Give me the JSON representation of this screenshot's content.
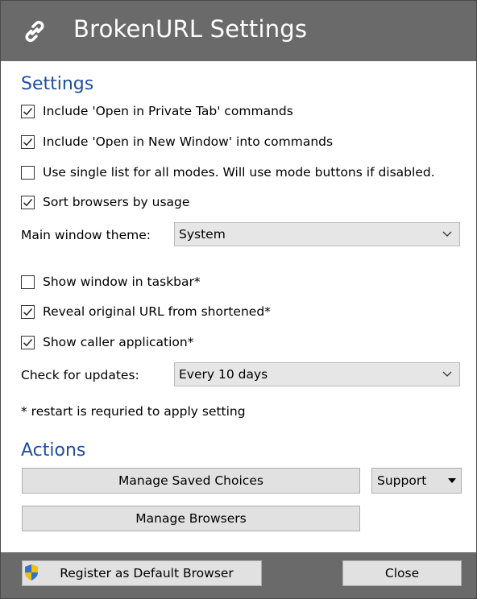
{
  "window": {
    "title": "BrokenURL Settings",
    "icon": "chain-link-icon"
  },
  "settings": {
    "heading": "Settings",
    "options": [
      {
        "label": "Include 'Open in Private Tab' commands",
        "checked": true
      },
      {
        "label": "Include 'Open in New Window' into commands",
        "checked": true
      },
      {
        "label": "Use single list for all modes. Will use mode buttons if disabled.",
        "checked": false
      },
      {
        "label": "Sort browsers by usage",
        "checked": true
      }
    ],
    "theme": {
      "label": "Main window theme:",
      "value": "System"
    },
    "options2": [
      {
        "label": "Show window in taskbar*",
        "checked": false
      },
      {
        "label": "Reveal original URL from shortened*",
        "checked": true
      },
      {
        "label": "Show caller application*",
        "checked": true
      }
    ],
    "updates": {
      "label": "Check for updates:",
      "value": "Every 10 days"
    },
    "note": "* restart is requried to apply setting"
  },
  "actions": {
    "heading": "Actions",
    "manage_saved": "Manage Saved Choices",
    "support": "Support",
    "manage_browsers": "Manage Browsers"
  },
  "footer": {
    "register": "Register as Default Browser",
    "close": "Close"
  }
}
